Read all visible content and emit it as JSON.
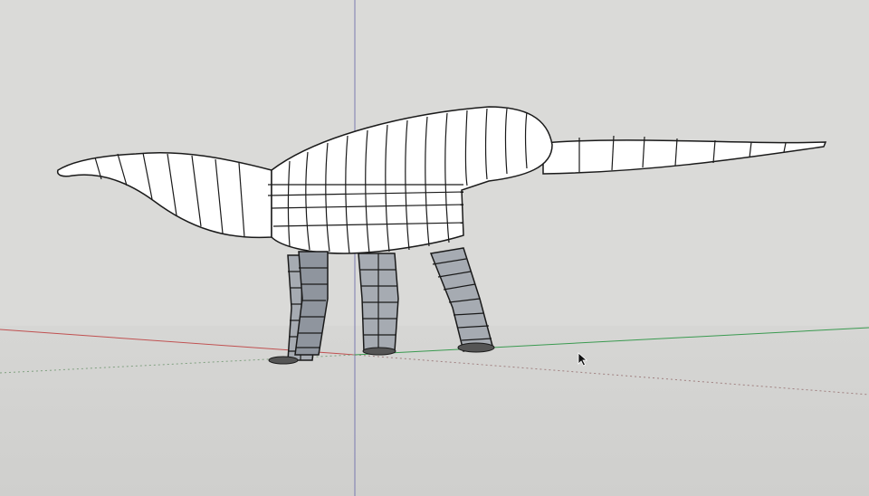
{
  "app": {
    "kind": "3d-modeling-viewport"
  },
  "viewport": {
    "model": "dinosaur-wireframe-sculpture",
    "axes": {
      "red": "#c05050",
      "green": "#3a9a50",
      "blue": "#7a7ab0"
    },
    "colors": {
      "sky": "#dadad8",
      "ground": "#d2d2d0",
      "model_fill": "#ffffff",
      "model_stroke": "#1a1a1a",
      "leg_fill": "#9aa0a8"
    }
  },
  "cursor": {
    "icon": "arrow-pointer-icon"
  }
}
